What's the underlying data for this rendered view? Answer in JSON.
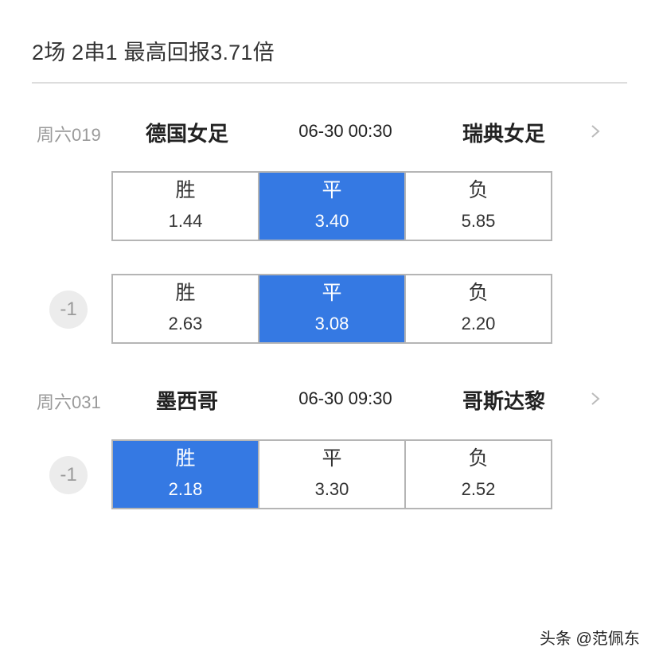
{
  "header": {
    "title": "2场 2串1 最高回报3.71倍"
  },
  "matches": [
    {
      "id": "周六019",
      "home": "德国女足",
      "time": "06-30 00:30",
      "away": "瑞典女足",
      "markets": [
        {
          "handicap": null,
          "options": [
            {
              "label": "胜",
              "odds": "1.44",
              "selected": false
            },
            {
              "label": "平",
              "odds": "3.40",
              "selected": true
            },
            {
              "label": "负",
              "odds": "5.85",
              "selected": false
            }
          ]
        },
        {
          "handicap": "-1",
          "options": [
            {
              "label": "胜",
              "odds": "2.63",
              "selected": false
            },
            {
              "label": "平",
              "odds": "3.08",
              "selected": true
            },
            {
              "label": "负",
              "odds": "2.20",
              "selected": false
            }
          ]
        }
      ]
    },
    {
      "id": "周六031",
      "home": "墨西哥",
      "time": "06-30 09:30",
      "away": "哥斯达黎",
      "markets": [
        {
          "handicap": "-1",
          "options": [
            {
              "label": "胜",
              "odds": "2.18",
              "selected": true
            },
            {
              "label": "平",
              "odds": "3.30",
              "selected": false
            },
            {
              "label": "负",
              "odds": "2.52",
              "selected": false
            }
          ]
        }
      ]
    }
  ],
  "icons": {
    "chevron": "chevron-right-icon"
  },
  "colors": {
    "selected": "#3579e3",
    "border": "#b5b5b5",
    "muted_text": "#9a9a9a"
  },
  "watermark": "头条 @范佩东"
}
